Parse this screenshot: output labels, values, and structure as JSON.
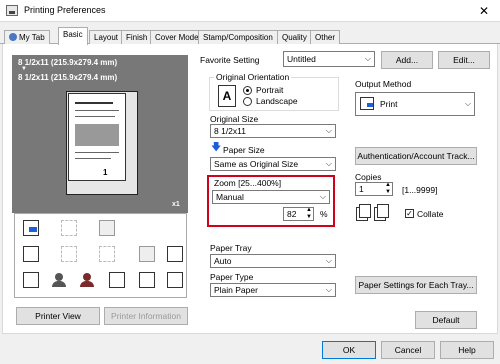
{
  "window": {
    "title": "Printing Preferences",
    "close_glyph": "✕"
  },
  "tabs": [
    "My Tab",
    "Basic",
    "Layout",
    "Finish",
    "Cover Mode",
    "Stamp/Composition",
    "Quality",
    "Other"
  ],
  "active_tab": "Basic",
  "favorite": {
    "label": "Favorite Setting",
    "value": "Untitled",
    "add": "Add...",
    "edit": "Edit..."
  },
  "preview": {
    "line1": "8 1/2x11 (215.9x279.4 mm)",
    "arrow": "▼",
    "line2": "8 1/2x11 (215.9x279.4 mm)",
    "page_number": "1",
    "copies_marker": "x1"
  },
  "bottom_left": {
    "printer_view": "Printer View",
    "printer_information": "Printer Information"
  },
  "original_orientation": {
    "label": "Original Orientation",
    "portrait": "Portrait",
    "landscape": "Landscape",
    "selected": "Portrait",
    "icon_letter": "A"
  },
  "original_size": {
    "label": "Original Size",
    "value": "8 1/2x11"
  },
  "paper_size": {
    "label": "Paper Size",
    "value": "Same as Original Size"
  },
  "zoom": {
    "label": "Zoom [25...400%]",
    "mode": "Manual",
    "value": "82",
    "unit": "%"
  },
  "paper_tray": {
    "label": "Paper Tray",
    "value": "Auto"
  },
  "paper_type": {
    "label": "Paper Type",
    "value": "Plain Paper"
  },
  "output_method": {
    "label": "Output Method",
    "value": "Print"
  },
  "auth_button": "Authentication/Account Track...",
  "copies": {
    "label": "Copies",
    "value": "1",
    "range": "[1...9999]",
    "collate_label": "Collate",
    "collate_checked": true
  },
  "paper_settings_button": "Paper Settings for Each Tray...",
  "default_button": "Default",
  "footer": {
    "ok": "OK",
    "cancel": "Cancel",
    "help": "Help"
  },
  "colors": {
    "highlight": "#d0021b",
    "preview_bg": "#787878",
    "accent_blue": "#1f5fd6"
  }
}
